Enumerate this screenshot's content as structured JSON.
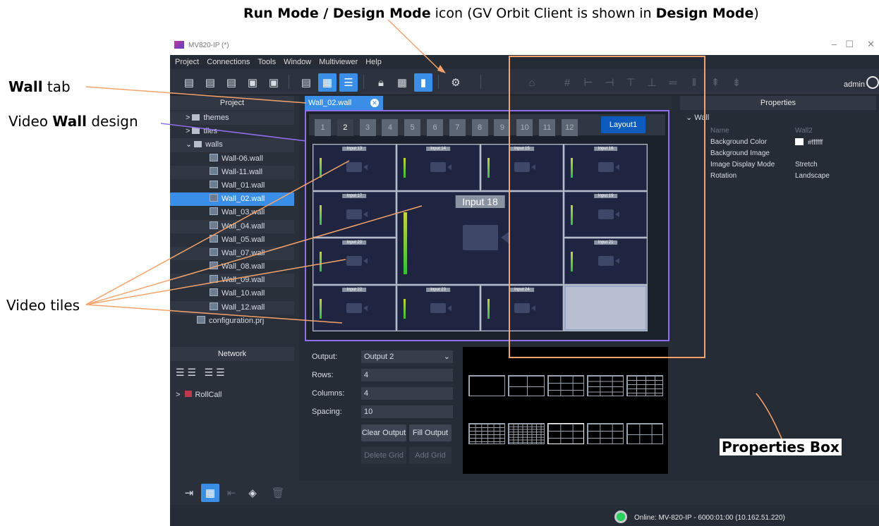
{
  "annotations": {
    "top_bold1": "Run Mode / Design Mode",
    "top_text1": " icon (GV Orbit Client is shown in ",
    "top_bold2": "Design Mode",
    "top_text2": ")",
    "wall_tab_bold": "Wall",
    "wall_tab_text": " tab",
    "video_wall_text1": "Video ",
    "video_wall_bold": "Wall",
    "video_wall_text2": " design",
    "video_tiles": "Video tiles",
    "properties_box": "Properties Box"
  },
  "window": {
    "title": "MV820-IP (*)"
  },
  "menu": [
    "Project",
    "Connections",
    "Tools",
    "Window",
    "Multiviewer",
    "Help"
  ],
  "toolbar": {
    "user": "admin"
  },
  "project_panel": {
    "title": "Project",
    "items": [
      {
        "label": "themes",
        "kind": "folder"
      },
      {
        "label": "tiles",
        "kind": "folder"
      },
      {
        "label": "walls",
        "kind": "folder"
      },
      {
        "label": "Wall-06.wall",
        "kind": "wall"
      },
      {
        "label": "Wall-11.wall",
        "kind": "wall"
      },
      {
        "label": "Wall_01.wall",
        "kind": "wall"
      },
      {
        "label": "Wall_02.wall",
        "kind": "wall",
        "selected": true
      },
      {
        "label": "Wall_03.wall",
        "kind": "wall"
      },
      {
        "label": "Wall_04.wall",
        "kind": "wall"
      },
      {
        "label": "Wall_05.wall",
        "kind": "wall"
      },
      {
        "label": "Wall_07.wall",
        "kind": "wall"
      },
      {
        "label": "Wall_08.wall",
        "kind": "wall"
      },
      {
        "label": "Wall_09.wall",
        "kind": "wall"
      },
      {
        "label": "Wall_10.wall",
        "kind": "wall"
      },
      {
        "label": "Wall_12.wall",
        "kind": "wall"
      },
      {
        "label": "configuration.prj",
        "kind": "file"
      }
    ]
  },
  "network_panel": {
    "title": "Network",
    "items": [
      "RollCall"
    ]
  },
  "editor_tab": {
    "label": "Wall_02.wall"
  },
  "wall": {
    "page_numbers": [
      "1",
      "2",
      "3",
      "4",
      "5",
      "6",
      "7",
      "8",
      "9",
      "10",
      "11",
      "12"
    ],
    "active_page": "2",
    "layout_button": "Layout1",
    "tiles": [
      "Input 13",
      "Input 14",
      "Input 15",
      "Input 16",
      "Input 17",
      "Input 18",
      "Input 19",
      "Input 20",
      "Input 21",
      "Input 22",
      "Input 23",
      "Input 24"
    ]
  },
  "output_panel": {
    "output_label": "Output:",
    "output_value": "Output 2",
    "rows_label": "Rows:",
    "rows_value": "4",
    "columns_label": "Columns:",
    "columns_value": "4",
    "spacing_label": "Spacing:",
    "spacing_value": "10",
    "clear_output": "Clear Output",
    "fill_output": "Fill Output",
    "delete_grid": "Delete Grid",
    "add_grid": "Add Grid"
  },
  "properties": {
    "title": "Properties",
    "section": "Wall",
    "rows": [
      {
        "name": "Name",
        "value": "Wall2",
        "dim": true
      },
      {
        "name": "Background Color",
        "value": "#ffffff",
        "swatch": "#ffffff"
      },
      {
        "name": "Background Image",
        "value": ""
      },
      {
        "name": "Image Display Mode",
        "value": "Stretch"
      },
      {
        "name": "Rotation",
        "value": "Landscape"
      }
    ]
  },
  "status": {
    "text": "Online: MV-820-IP - 6000:01:00 (10.162.51.220)"
  },
  "colors": {
    "accent": "#3b8ee5",
    "wall_border": "#8f6ff0",
    "annotation_line": "#f5a36a",
    "status_ok": "#27d05a"
  }
}
